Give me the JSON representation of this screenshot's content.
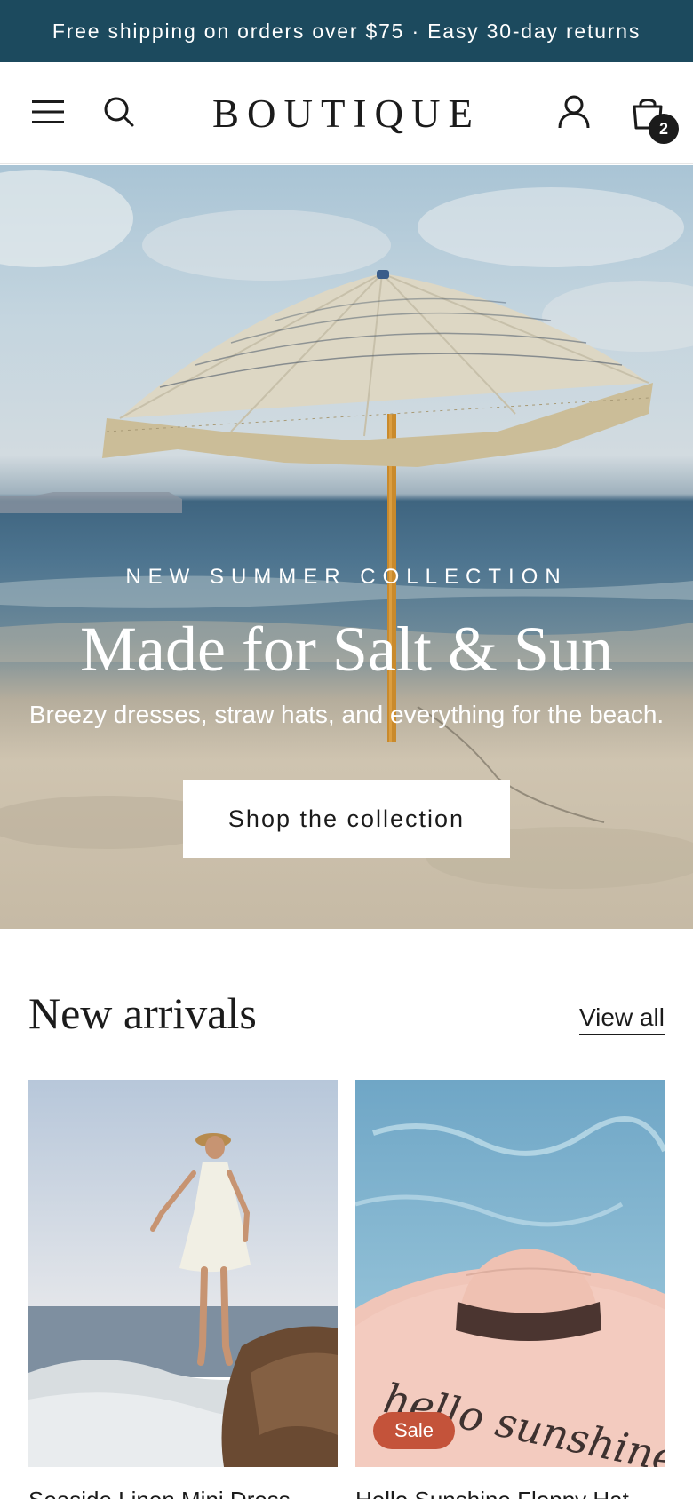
{
  "announcement": {
    "text": "Free shipping on orders over $75 · Easy 30-day returns"
  },
  "header": {
    "brand": "BOUTIQUE",
    "cart_count": "2",
    "icons": {
      "menu": "menu-icon",
      "search": "search-icon",
      "account": "account-icon",
      "cart": "cart-icon"
    }
  },
  "hero": {
    "eyebrow": "NEW SUMMER COLLECTION",
    "title": "Made for Salt & Sun",
    "subtitle": "Breezy dresses, straw hats, and everything for the beach.",
    "cta_label": "Shop the collection"
  },
  "new_arrivals": {
    "title": "New arrivals",
    "view_all_label": "View all",
    "products": [
      {
        "name": "Seaside Linen Mini Dress",
        "badge": ""
      },
      {
        "name": "Hello Sunshine Floppy Hat",
        "badge": "Sale",
        "hat_text": "hello sunshine"
      }
    ]
  },
  "colors": {
    "announcement_bg": "#1c4a5e",
    "sale_badge": "#c4533a",
    "text": "#1b1b1b"
  }
}
